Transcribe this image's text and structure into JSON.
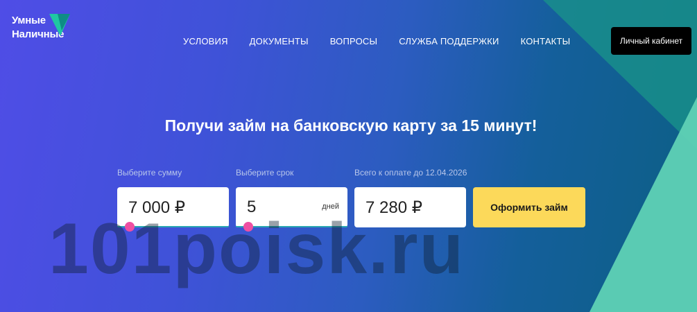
{
  "logo": {
    "line1": "Умные",
    "line2": "Наличные"
  },
  "nav": {
    "items": [
      {
        "label": "УСЛОВИЯ"
      },
      {
        "label": "ДОКУМЕНТЫ"
      },
      {
        "label": "ВОПРОСЫ"
      },
      {
        "label": "СЛУЖБА ПОДДЕРЖКИ"
      },
      {
        "label": "КОНТАКТЫ"
      }
    ]
  },
  "header": {
    "cabinet_label": "Личный кабинет"
  },
  "hero": {
    "title": "Получи займ на банковскую карту за 15 минут!"
  },
  "calculator": {
    "amount": {
      "label": "Выберите сумму",
      "value": "7 000 ₽"
    },
    "term": {
      "label": "Выберите срок",
      "value": "5",
      "unit": "дней"
    },
    "total": {
      "label": "Всего к оплате до 12.04.2026",
      "value": "7 280 ₽"
    },
    "apply_label": "Оформить займ"
  },
  "watermark": "101poisk.ru",
  "colors": {
    "accent_button": "#fcd95a",
    "slider_handle": "#ee4fa2",
    "track": "#2aa7b2"
  }
}
